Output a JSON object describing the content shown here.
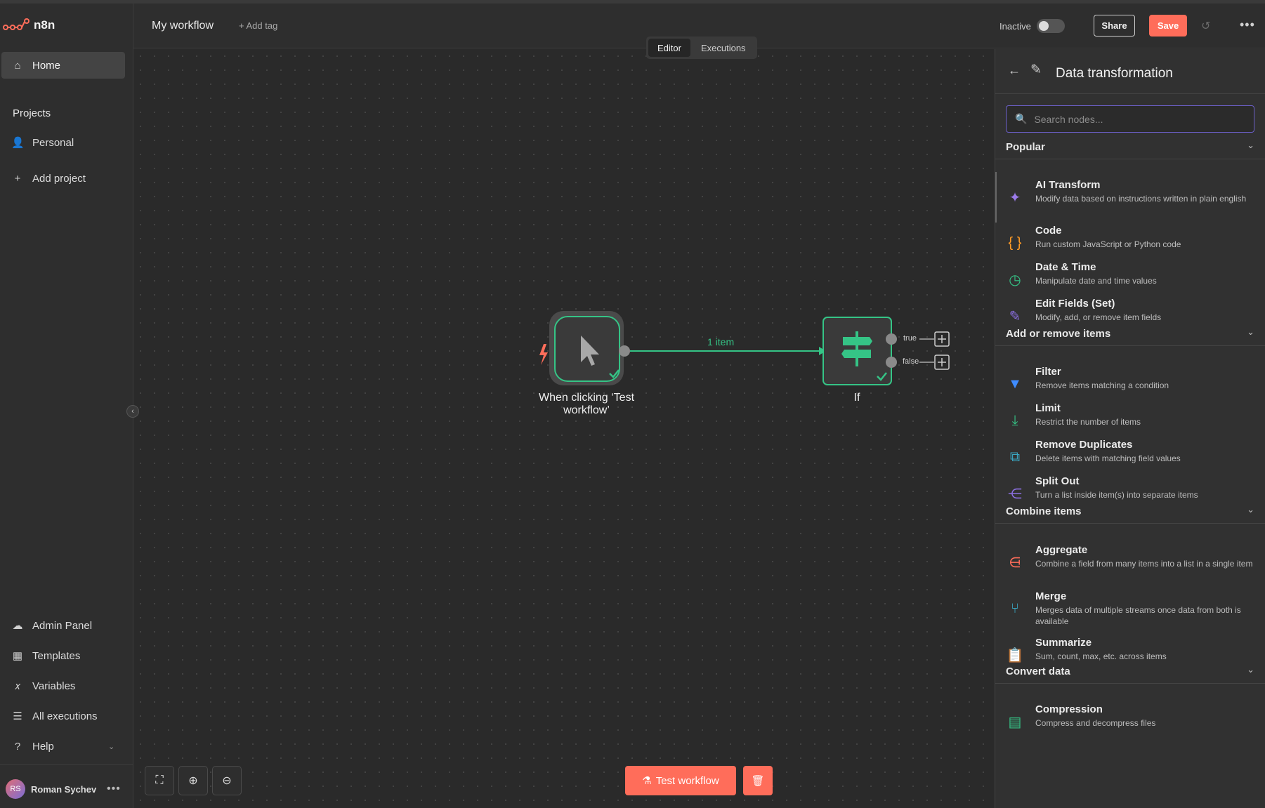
{
  "app": {
    "logo_text": "n8n"
  },
  "sidebar": {
    "home": "Home",
    "projects_label": "Projects",
    "personal": "Personal",
    "add_project": "Add project",
    "admin_panel": "Admin Panel",
    "templates": "Templates",
    "variables": "Variables",
    "all_executions": "All executions",
    "help": "Help",
    "user_initials": "RS",
    "user_name": "Roman Sychev"
  },
  "header": {
    "workflow_name": "My workflow",
    "add_tag": "+ Add tag",
    "status_label": "Inactive",
    "active": false,
    "share": "Share",
    "save": "Save",
    "tabs": [
      {
        "label": "Editor",
        "active": true
      },
      {
        "label": "Executions",
        "active": false
      }
    ]
  },
  "canvas": {
    "trigger_node_label": "When clicking ‘Test workflow’",
    "if_node_label": "If",
    "edge_label": "1 item",
    "port_true": "true",
    "port_false": "false",
    "test_button": "Test workflow"
  },
  "panel": {
    "title": "Data transformation",
    "search_placeholder": "Search nodes...",
    "categories": [
      {
        "title": "Popular",
        "items": [
          {
            "name": "AI Transform",
            "desc": "Modify data based on instructions written in plain english",
            "icon": "sparkle-icon",
            "color": "#9b7bea"
          },
          {
            "name": "Code",
            "desc": "Run custom JavaScript or Python code",
            "icon": "braces-icon",
            "color": "#ff9b26"
          },
          {
            "name": "Date & Time",
            "desc": "Manipulate date and time values",
            "icon": "clock-icon",
            "color": "#35c486"
          },
          {
            "name": "Edit Fields (Set)",
            "desc": "Modify, add, or remove item fields",
            "icon": "pencil-icon",
            "color": "#8b6fe0"
          }
        ]
      },
      {
        "title": "Add or remove items",
        "items": [
          {
            "name": "Filter",
            "desc": "Remove items matching a condition",
            "icon": "filter-icon",
            "color": "#3f8cff"
          },
          {
            "name": "Limit",
            "desc": "Restrict the number of items",
            "icon": "limit-icon",
            "color": "#35c486"
          },
          {
            "name": "Remove Duplicates",
            "desc": "Delete items with matching field values",
            "icon": "duplicates-icon",
            "color": "#3aa8c4"
          },
          {
            "name": "Split Out",
            "desc": "Turn a list inside item(s) into separate items",
            "icon": "split-icon",
            "color": "#8b6fe0"
          }
        ]
      },
      {
        "title": "Combine items",
        "items": [
          {
            "name": "Aggregate",
            "desc": "Combine a field from many items into a list in a single item",
            "icon": "aggregate-icon",
            "color": "#ff6d5a"
          },
          {
            "name": "Merge",
            "desc": "Merges data of multiple streams once data from both is available",
            "icon": "merge-icon",
            "color": "#3aa8c4"
          },
          {
            "name": "Summarize",
            "desc": "Sum, count, max, etc. across items",
            "icon": "clipboard-icon",
            "color": "#ff9b26"
          }
        ]
      },
      {
        "title": "Convert data",
        "items": [
          {
            "name": "Compression",
            "desc": "Compress and decompress files",
            "icon": "file-zip-icon",
            "color": "#35c486"
          }
        ]
      }
    ]
  },
  "colors": {
    "accent": "#ff6d5a",
    "success": "#35c486",
    "panel_bg": "#313131",
    "canvas_bg": "#2a2a2a"
  }
}
